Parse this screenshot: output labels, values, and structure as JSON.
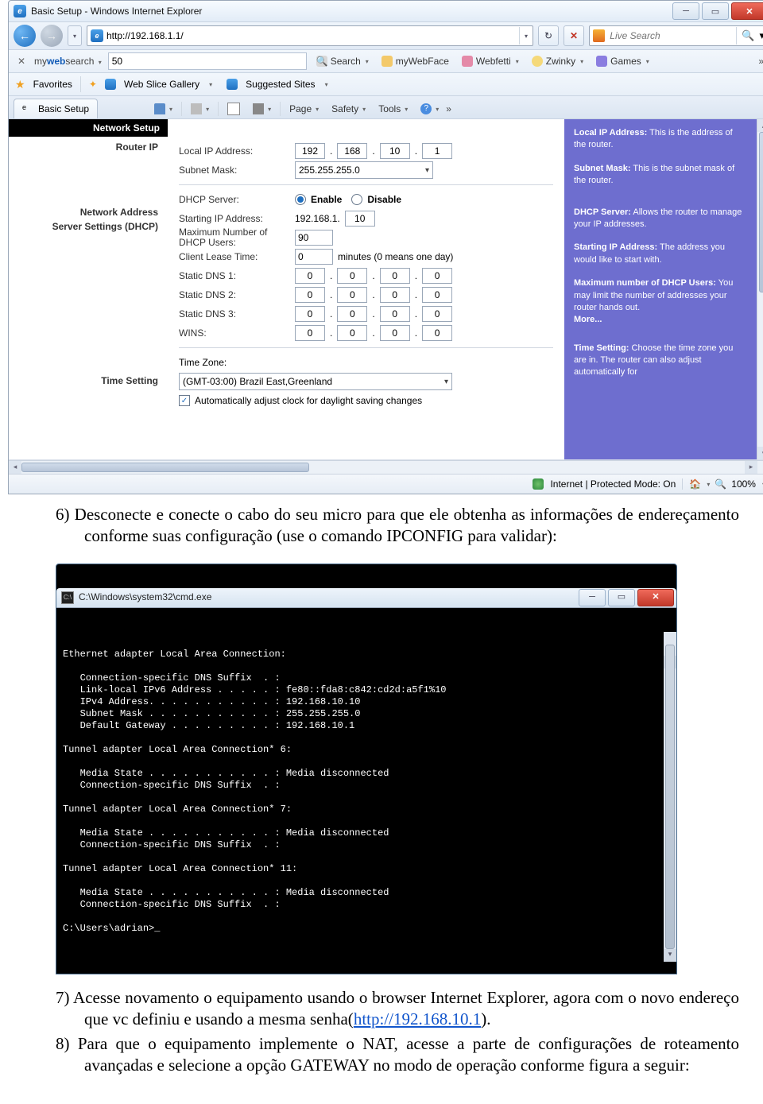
{
  "ie": {
    "window_title": "Basic Setup - Windows Internet Explorer",
    "url": "http://192.168.1.1/",
    "search_placeholder": "Live Search",
    "mws_search_value": "50",
    "mws_brand": {
      "pre": "my",
      "mid": "web",
      "post": "search"
    },
    "tb_items": {
      "search": "Search",
      "mywebface": "myWebFace",
      "webfetti": "Webfetti",
      "zwinky": "Zwinky",
      "games": "Games"
    },
    "fav_label": "Favorites",
    "fav_links": {
      "gallery": "Web Slice Gallery",
      "suggested": "Suggested Sites"
    },
    "tab_label": "Basic Setup",
    "menu": {
      "page": "Page",
      "safety": "Safety",
      "tools": "Tools"
    },
    "status": {
      "mode": "Internet | Protected Mode: On",
      "zoom": "100%"
    }
  },
  "router": {
    "section": "Network Setup",
    "router_ip_label": "Router IP",
    "local_ip_label": "Local IP Address:",
    "ip": [
      "192",
      "168",
      "10",
      "1"
    ],
    "subnet_label": "Subnet Mask:",
    "subnet": "255.255.255.0",
    "dhcp_section": "Network Address Server Settings (DHCP)",
    "dhcp_server_label": "DHCP Server:",
    "enable": "Enable",
    "disable": "Disable",
    "start_ip_label": "Starting IP Address:",
    "start_ip_prefix": "192.168.1.",
    "start_ip_val": "10",
    "max_users_label": "Maximum Number of DHCP Users:",
    "max_users": "90",
    "lease_label": "Client Lease Time:",
    "lease_val": "0",
    "lease_hint": "minutes (0 means one day)",
    "dns1": "Static DNS 1:",
    "dns2": "Static DNS 2:",
    "dns3": "Static DNS 3:",
    "wins": "WINS:",
    "zeros": [
      "0",
      "0",
      "0",
      "0"
    ],
    "time_section": "Time Setting",
    "tz_label": "Time Zone:",
    "tz_value": "(GMT-03:00) Brazil East,Greenland",
    "dst_label": "Automatically adjust clock for daylight saving changes"
  },
  "help": {
    "p1b": "Local IP Address:",
    "p1": " This is the address of the router.",
    "p2b": "Subnet Mask:",
    "p2": " This is the subnet mask of the router.",
    "p3b": "DHCP Server:",
    "p3": " Allows the router to manage your IP addresses.",
    "p4b": "Starting IP Address:",
    "p4": " The address you would like to start with.",
    "p5b": "Maximum number of DHCP Users:",
    "p5": " You may limit the number of addresses your router hands out.",
    "more": "More...",
    "p6b": "Time Setting:",
    "p6": " Choose the time zone you are in. The router can also adjust automatically for"
  },
  "doc": {
    "s6": "6) Desconecte e conecte o cabo do seu micro para que ele obtenha as informações de endereçamento conforme suas configuração (use o comando IPCONFIG para validar):",
    "s7a": "7) Acesse novamento o equipamento usando o browser Internet Explorer, agora com o novo endereço que vc definiu e usando a mesma senha(",
    "s7link": "http://192.168.10.1",
    "s7b": ").",
    "s8": "8) Para que o equipamento implemente o NAT, acesse a parte de configurações de roteamento avançadas e selecione a opção GATEWAY no modo de operação conforme figura a seguir:"
  },
  "cmd": {
    "title": "C:\\Windows\\system32\\cmd.exe",
    "body": "\nEthernet adapter Local Area Connection:\n\n   Connection-specific DNS Suffix  . :\n   Link-local IPv6 Address . . . . . : fe80::fda8:c842:cd2d:a5f1%10\n   IPv4 Address. . . . . . . . . . . : 192.168.10.10\n   Subnet Mask . . . . . . . . . . . : 255.255.255.0\n   Default Gateway . . . . . . . . . : 192.168.10.1\n\nTunnel adapter Local Area Connection* 6:\n\n   Media State . . . . . . . . . . . : Media disconnected\n   Connection-specific DNS Suffix  . :\n\nTunnel adapter Local Area Connection* 7:\n\n   Media State . . . . . . . . . . . : Media disconnected\n   Connection-specific DNS Suffix  . :\n\nTunnel adapter Local Area Connection* 11:\n\n   Media State . . . . . . . . . . . : Media disconnected\n   Connection-specific DNS Suffix  . :\n\nC:\\Users\\adrian>_"
  }
}
